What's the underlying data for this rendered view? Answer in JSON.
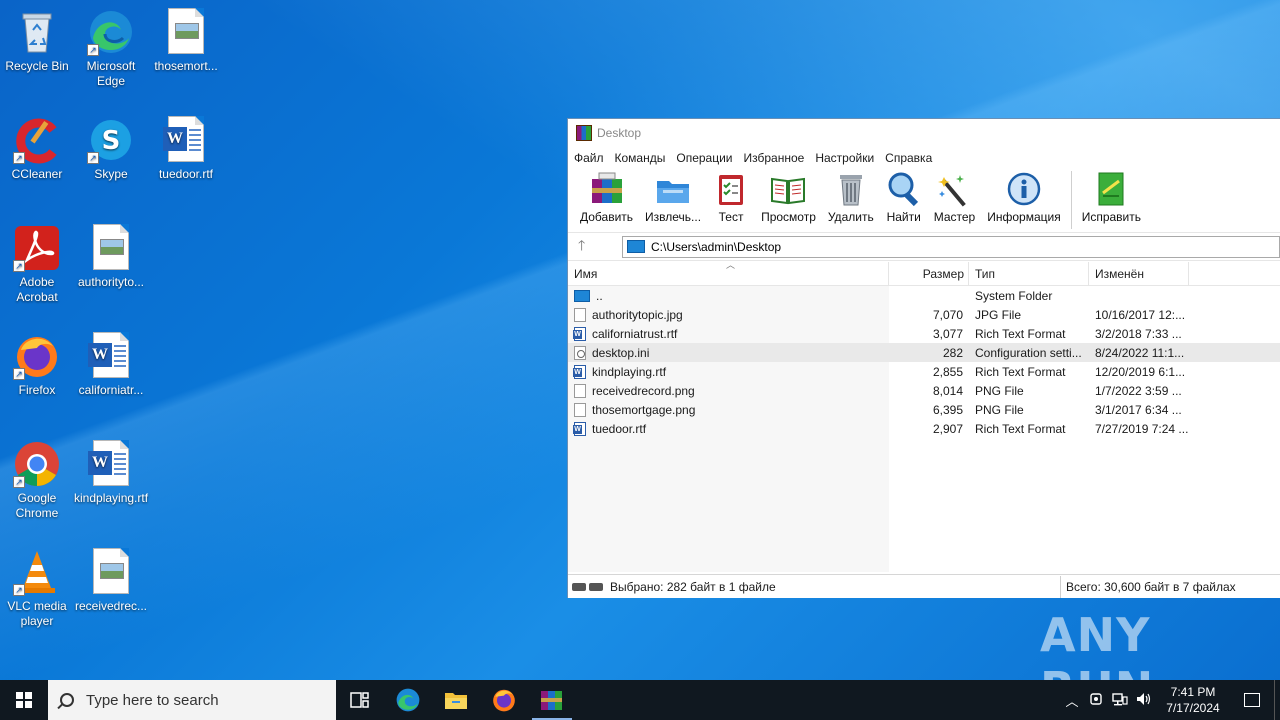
{
  "desktop": {
    "icons": [
      {
        "label": "Recycle Bin"
      },
      {
        "label": "Microsoft Edge"
      },
      {
        "label": "thosemort..."
      },
      {
        "label": "CCleaner"
      },
      {
        "label": "Skype"
      },
      {
        "label": "tuedoor.rtf"
      },
      {
        "label": "Adobe Acrobat"
      },
      {
        "label": "authorityto..."
      },
      {
        "label": "Firefox"
      },
      {
        "label": "californiatr..."
      },
      {
        "label": "Google Chrome"
      },
      {
        "label": "kindplaying.rtf"
      },
      {
        "label": "VLC media player"
      },
      {
        "label": "receivedrec..."
      }
    ],
    "watermark": "ANY RUN"
  },
  "window": {
    "title": "Desktop",
    "menu": [
      "Файл",
      "Команды",
      "Операции",
      "Избранное",
      "Настройки",
      "Справка"
    ],
    "toolbar": [
      {
        "label": "Добавить",
        "icon": "add-archive-icon"
      },
      {
        "label": "Извлечь...",
        "icon": "extract-folder-icon"
      },
      {
        "label": "Тест",
        "icon": "test-clipboard-icon"
      },
      {
        "label": "Просмотр",
        "icon": "view-book-icon"
      },
      {
        "label": "Удалить",
        "icon": "trash-icon"
      },
      {
        "label": "Найти",
        "icon": "magnifier-icon"
      },
      {
        "label": "Мастер",
        "icon": "wizard-wand-icon"
      },
      {
        "label": "Информация",
        "icon": "info-icon"
      },
      {
        "label": "Исправить",
        "icon": "repair-icon"
      }
    ],
    "address": "C:\\Users\\admin\\Desktop",
    "columns": {
      "name": "Имя",
      "size": "Размер",
      "type": "Тип",
      "modified": "Изменён"
    },
    "files": [
      {
        "name": "..",
        "size": "",
        "type": "System Folder",
        "modified": "",
        "icon": "up"
      },
      {
        "name": "authoritytopic.jpg",
        "size": "7,070",
        "type": "JPG File",
        "modified": "10/16/2017 12:...",
        "icon": "file"
      },
      {
        "name": "californiatrust.rtf",
        "size": "3,077",
        "type": "Rich Text Format",
        "modified": "3/2/2018 7:33 ...",
        "icon": "word"
      },
      {
        "name": "desktop.ini",
        "size": "282",
        "type": "Configuration setti...",
        "modified": "8/24/2022 11:1...",
        "icon": "ini",
        "selected": true
      },
      {
        "name": "kindplaying.rtf",
        "size": "2,855",
        "type": "Rich Text Format",
        "modified": "12/20/2019 6:1...",
        "icon": "word"
      },
      {
        "name": "receivedrecord.png",
        "size": "8,014",
        "type": "PNG File",
        "modified": "1/7/2022 3:59 ...",
        "icon": "file"
      },
      {
        "name": "thosemortgage.png",
        "size": "6,395",
        "type": "PNG File",
        "modified": "3/1/2017 6:34 ...",
        "icon": "file"
      },
      {
        "name": "tuedoor.rtf",
        "size": "2,907",
        "type": "Rich Text Format",
        "modified": "7/27/2019 7:24 ...",
        "icon": "word"
      }
    ],
    "status_left": "Выбрано: 282 байт в 1 файле",
    "status_right": "Всего: 30,600 байт в 7 файлах"
  },
  "taskbar": {
    "search_placeholder": "Type here to search",
    "time": "7:41 PM",
    "date": "7/17/2024"
  }
}
